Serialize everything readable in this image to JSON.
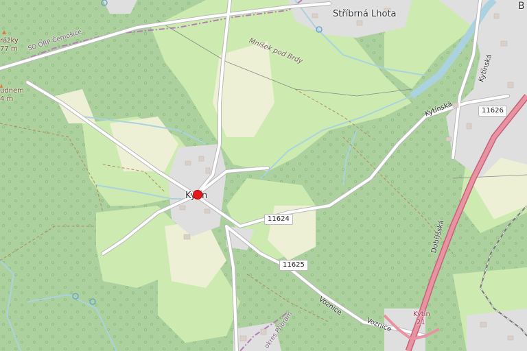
{
  "map": {
    "places": {
      "stribrna_lhota": "Stříbrná Lhota",
      "kytin_village": "Kytín",
      "edge_b": "B"
    },
    "peaks": {
      "peak1_name": "rážky",
      "peak1_ele": "77 m",
      "peak2_name": "udnem",
      "peak2_ele": "4 m"
    },
    "boundaries": {
      "orp": "SO ORP Černošice",
      "okres": "okres Příbram"
    },
    "mountain": "Mníšek pod Brdy",
    "roads": {
      "kytinska_1": "Kytínská",
      "kytinska_2": "Kytínská",
      "dobrisska": "Dobříšská",
      "voznice_1": "Voznice",
      "voznice_2": "Voznice",
      "highway_kytin": "Kytín",
      "highway_num": "21"
    },
    "shields": {
      "s1": "11626",
      "s2": "11624",
      "s3": "11625"
    },
    "colors": {
      "forest": "#add19e",
      "meadow": "#cdebb0",
      "farmland": "#eef0d5",
      "residential": "#e0dfdf",
      "water": "#aad3df",
      "motorway": "#e892a2",
      "marker": "#e31a1c"
    }
  }
}
